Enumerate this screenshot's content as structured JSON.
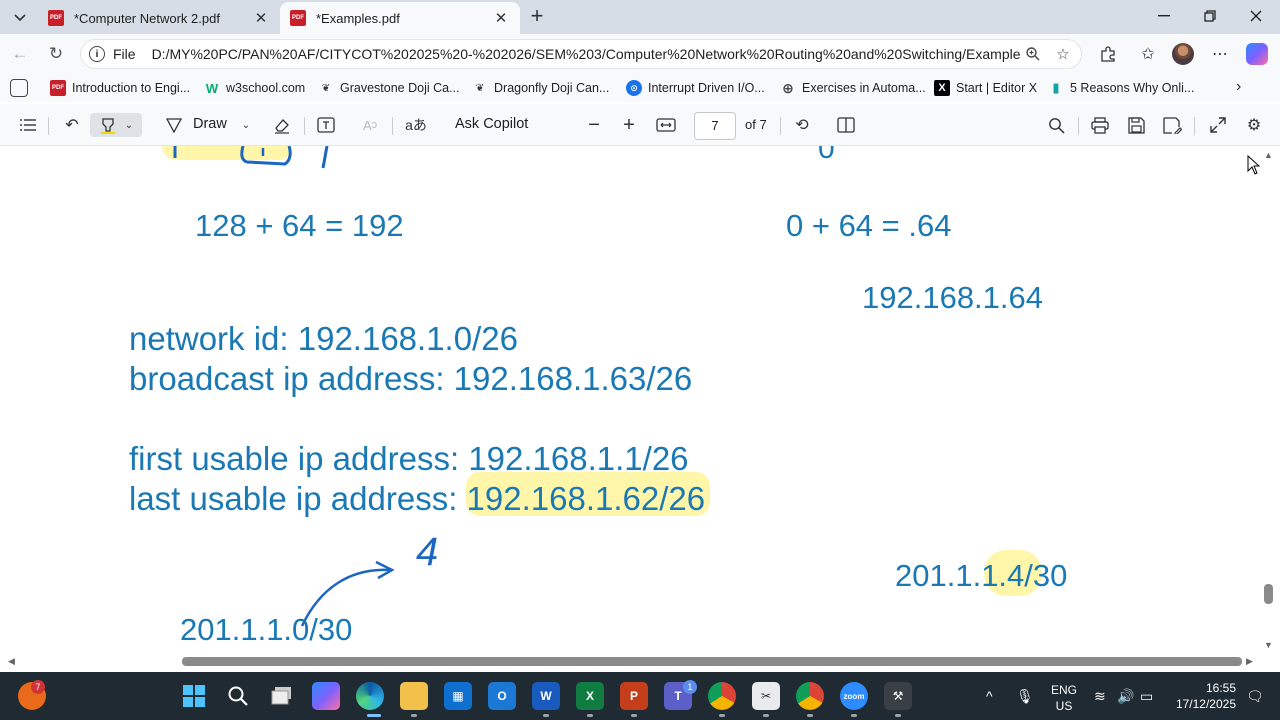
{
  "tabs": [
    {
      "title": "*Computer Network 2.pdf",
      "active": false
    },
    {
      "title": "*Examples.pdf",
      "active": true
    }
  ],
  "address": {
    "scheme_label": "File",
    "url": "D:/MY%20PC/PAN%20AF/CITYCOT%202025%20-%202026/SEM%203/Computer%20Network%20Routing%20and%20Switching/Examples.pdf"
  },
  "favorites": [
    {
      "label": "Introduction to Engi...",
      "icon": "pdf-icon"
    },
    {
      "label": "w3school.com",
      "icon": "w3schools-icon"
    },
    {
      "label": "Gravestone Doji Ca...",
      "icon": "candle-icon"
    },
    {
      "label": "Dragonfly Doji Can...",
      "icon": "candle-icon"
    },
    {
      "label": "Interrupt Driven I/O...",
      "icon": "site-icon"
    },
    {
      "label": "Exercises in Automa...",
      "icon": "globe-icon"
    },
    {
      "label": "Start | Editor X",
      "icon": "x-icon"
    },
    {
      "label": "5 Reasons Why Onli...",
      "icon": "book-icon"
    }
  ],
  "pdf_toolbar": {
    "draw_label": "Draw",
    "ask_copilot_label": "Ask Copilot",
    "page_current": "7",
    "page_total": "of 7"
  },
  "pdf_content": {
    "line_calc_left": "128 + 64 = 192",
    "line_calc_right": "0 + 64 = .64",
    "line_ip_right": "192.168.1.64",
    "network_id": "network id: 192.168.1.0/26",
    "broadcast": "broadcast ip address: 192.168.1.63/26",
    "first_usable": "first usable ip address: 192.168.1.1/26",
    "last_usable_label": "last usable ip address: ",
    "last_usable_value": "192.168.1.62/26",
    "handwritten_4": "4",
    "ip_201_left": "201.1.1.0/30",
    "ip_201_right": "201.1.1.4/30",
    "top_partial_digit": "0"
  },
  "taskbar": {
    "widgets_badge": "7",
    "teams_badge": "1",
    "lang_top": "ENG",
    "lang_bottom": "US",
    "time": "16:55",
    "date": "17/12/2025"
  },
  "colors": {
    "handwriting": "#1a78b4",
    "highlight": "#fff59a",
    "taskbar": "#1f2a33"
  }
}
